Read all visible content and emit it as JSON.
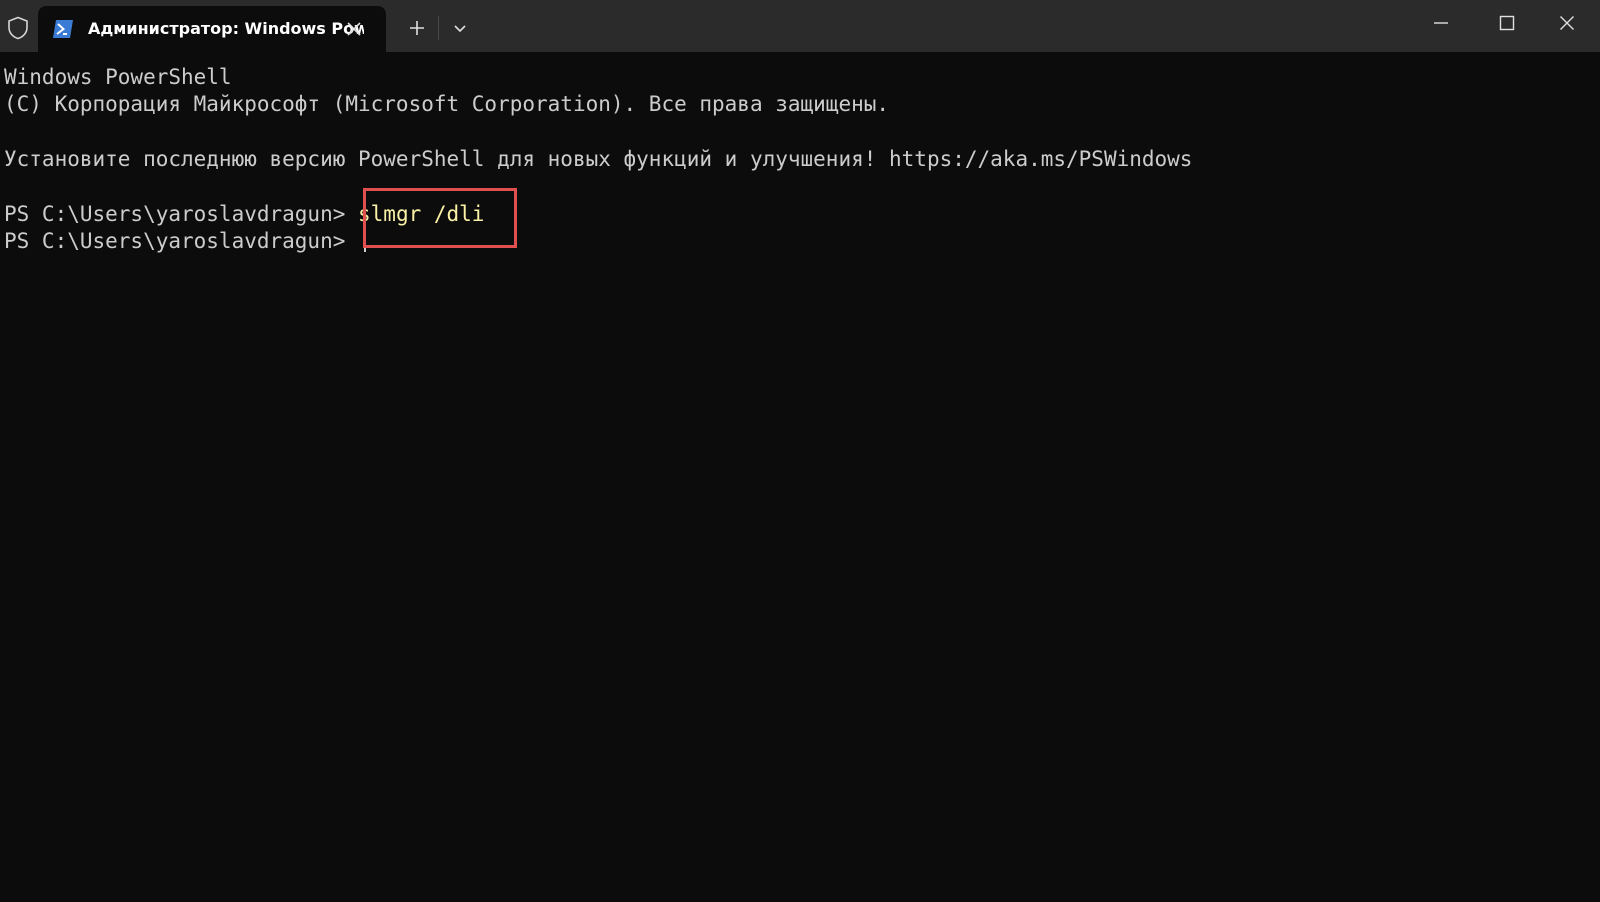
{
  "tab": {
    "title": "Администратор: Windows PowerShell",
    "close_icon": "close-icon",
    "app_icon": "powershell-icon"
  },
  "toolbar": {
    "shield_icon": "shield-icon",
    "new_tab_icon": "plus-icon",
    "dropdown_icon": "chevron-down-icon"
  },
  "window_controls": {
    "minimize_icon": "minimize-icon",
    "maximize_icon": "maximize-icon",
    "close_icon": "close-icon"
  },
  "terminal": {
    "lines": [
      "Windows PowerShell",
      "(C) Корпорация Майкрософт (Microsoft Corporation). Все права защищены.",
      "",
      "Установите последнюю версию PowerShell для новых функций и улучшения! https://aka.ms/PSWindows",
      ""
    ],
    "prompt": "PS C:\\Users\\yaroslavdragun> ",
    "command": "slmgr /dli",
    "second_prompt": "PS C:\\Users\\yaroslavdragun> "
  },
  "colors": {
    "background": "#0c0c0c",
    "titlebar": "#2b2b2b",
    "text": "#cccccc",
    "command_text": "#f9f1a5",
    "highlight_box": "#e0504f"
  }
}
